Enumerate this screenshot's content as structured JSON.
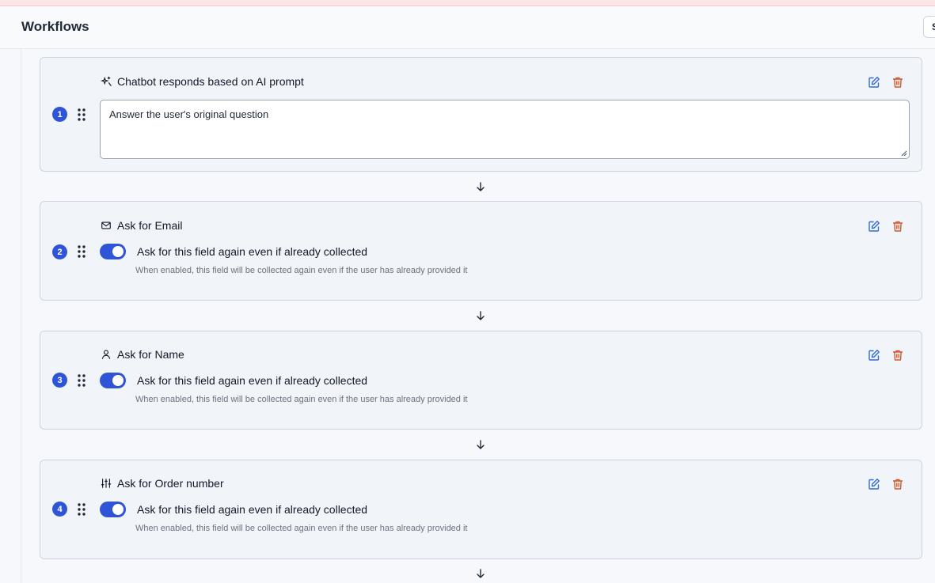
{
  "header": {
    "title": "Workflows",
    "right_button_label": "S"
  },
  "steps": [
    {
      "number": "1",
      "icon": "sparkles-icon",
      "title": "Chatbot responds based on AI prompt",
      "prompt_value": "Answer the user's original question"
    },
    {
      "number": "2",
      "icon": "mail-icon",
      "title": "Ask for Email",
      "toggle_on": true,
      "toggle_label": "Ask for this field again even if already collected",
      "toggle_help": "When enabled, this field will be collected again even if the user has already provided it"
    },
    {
      "number": "3",
      "icon": "user-icon",
      "title": "Ask for Name",
      "toggle_on": true,
      "toggle_label": "Ask for this field again even if already collected",
      "toggle_help": "When enabled, this field will be collected again even if the user has already provided it"
    },
    {
      "number": "4",
      "icon": "sliders-icon",
      "title": "Ask for Order number",
      "toggle_on": true,
      "toggle_label": "Ask for this field again even if already collected",
      "toggle_help": "When enabled, this field will be collected again even if the user has already provided it"
    }
  ],
  "colors": {
    "accent": "#2f54d6",
    "edit_icon": "#2f6bd6",
    "delete_icon": "#d4572a",
    "card_bg": "#f1f5f9",
    "card_border": "#cbd5e1"
  }
}
